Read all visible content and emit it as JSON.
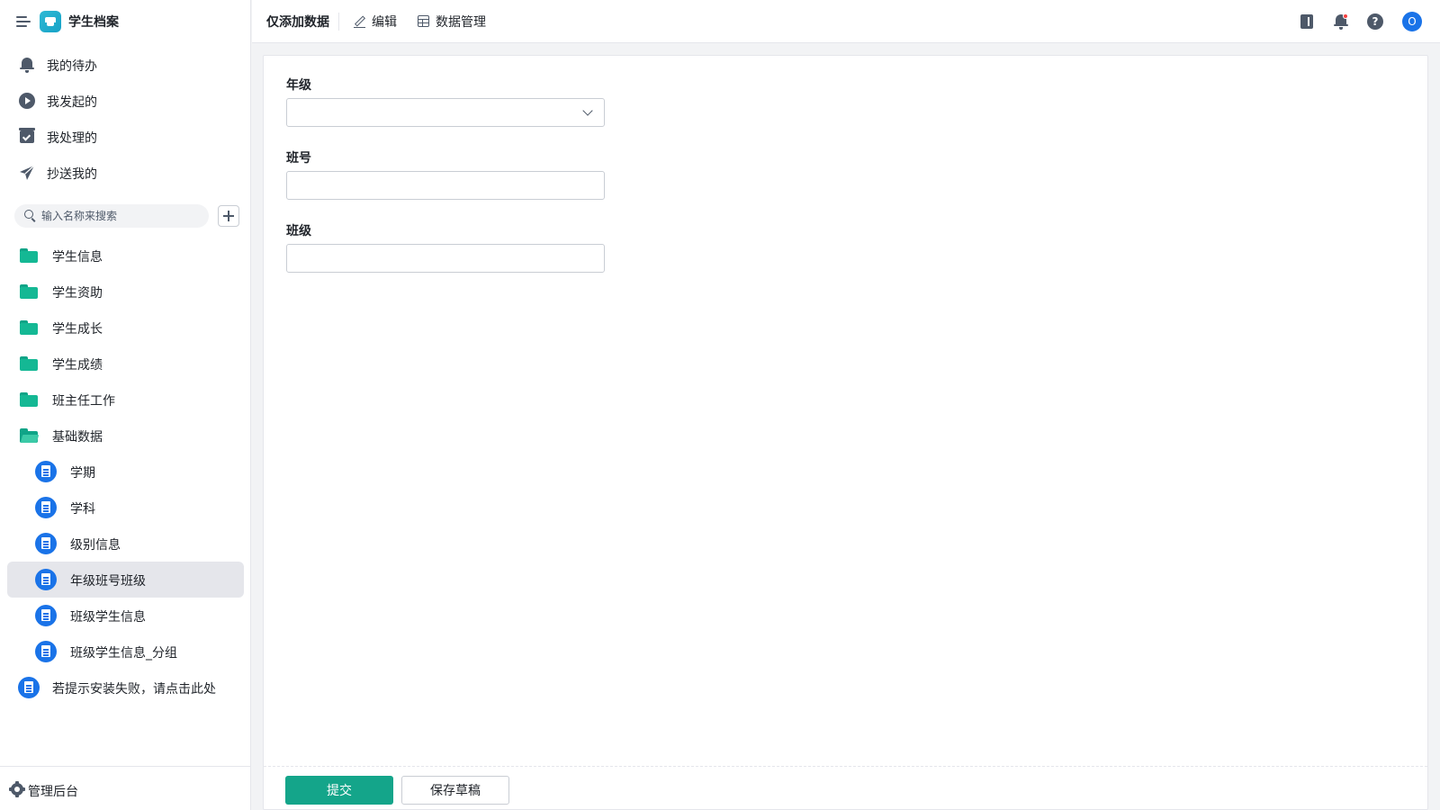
{
  "app": {
    "title": "学生档案"
  },
  "sidebar": {
    "nav": [
      {
        "label": "我的待办",
        "icon": "bell-icon"
      },
      {
        "label": "我发起的",
        "icon": "play-circle-icon"
      },
      {
        "label": "我处理的",
        "icon": "check-box-icon"
      },
      {
        "label": "抄送我的",
        "icon": "send-icon"
      }
    ],
    "search": {
      "placeholder": "输入名称来搜索",
      "value": ""
    },
    "tree": [
      {
        "label": "学生信息",
        "icon": "folder-icon"
      },
      {
        "label": "学生资助",
        "icon": "folder-icon"
      },
      {
        "label": "学生成长",
        "icon": "folder-icon"
      },
      {
        "label": "学生成绩",
        "icon": "folder-icon"
      },
      {
        "label": "班主任工作",
        "icon": "folder-icon"
      },
      {
        "label": "基础数据",
        "icon": "folder-open-icon",
        "expanded": true
      },
      {
        "label": "学期",
        "icon": "document-icon"
      },
      {
        "label": "学科",
        "icon": "document-icon"
      },
      {
        "label": "级别信息",
        "icon": "document-icon"
      },
      {
        "label": "年级班号班级",
        "icon": "document-icon",
        "active": true
      },
      {
        "label": "班级学生信息",
        "icon": "document-icon"
      },
      {
        "label": "班级学生信息_分组",
        "icon": "document-icon"
      },
      {
        "label": "若提示安装失败，请点击此处",
        "icon": "document-icon"
      }
    ],
    "footer": {
      "admin_label": "管理后台"
    }
  },
  "topbar": {
    "form_name": "仅添加数据",
    "edit_label": "编辑",
    "data_manage_label": "数据管理",
    "avatar_text": "O",
    "icons": [
      "book-icon",
      "bell-icon",
      "help-icon"
    ],
    "help_text": "?"
  },
  "form": {
    "fields": [
      {
        "label": "年级",
        "type": "select",
        "value": ""
      },
      {
        "label": "班号",
        "type": "text",
        "value": ""
      },
      {
        "label": "班级",
        "type": "text",
        "value": ""
      }
    ],
    "submit_label": "提交",
    "draft_label": "保存草稿"
  },
  "colors": {
    "accent": "#14a58a",
    "folder": "#14b894",
    "doc_icon": "#1a73e8",
    "active_bg": "#e5e6eb"
  }
}
